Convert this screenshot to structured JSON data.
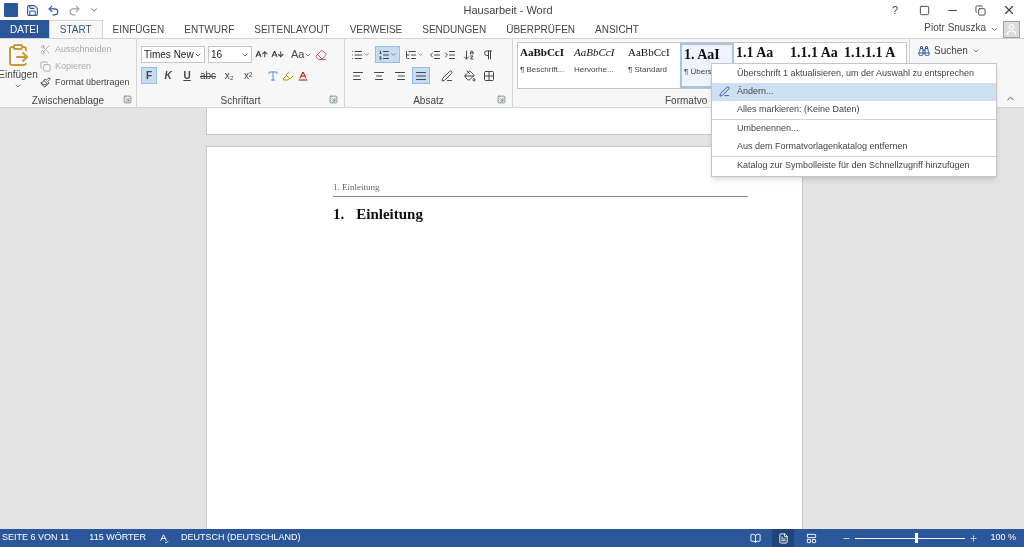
{
  "title_bar": {
    "title": "Hausarbeit - Word",
    "help": "?"
  },
  "tabs": [
    {
      "label": "DATEI",
      "kind": "file",
      "selected": false
    },
    {
      "label": "START",
      "kind": "tab",
      "selected": true
    },
    {
      "label": "EINFÜGEN",
      "kind": "tab",
      "selected": false
    },
    {
      "label": "ENTWURF",
      "kind": "tab",
      "selected": false
    },
    {
      "label": "SEITENLAYOUT",
      "kind": "tab",
      "selected": false
    },
    {
      "label": "VERWEISE",
      "kind": "tab",
      "selected": false
    },
    {
      "label": "SENDUNGEN",
      "kind": "tab",
      "selected": false
    },
    {
      "label": "ÜBERPRÜFEN",
      "kind": "tab",
      "selected": false
    },
    {
      "label": "ANSICHT",
      "kind": "tab",
      "selected": false
    }
  ],
  "user": {
    "name": "Piotr Snuszka"
  },
  "clipboard": {
    "label": "Zwischenablage",
    "paste": "Einfügen",
    "items": [
      {
        "label": "Ausschneiden",
        "disabled": true
      },
      {
        "label": "Kopieren",
        "disabled": true
      },
      {
        "label": "Format übertragen",
        "disabled": false
      }
    ]
  },
  "font": {
    "label": "Schriftart",
    "font_name": "Times New",
    "font_size": "16",
    "case_button": "Aa",
    "format_buttons": [
      {
        "label": "F",
        "kind": "bold",
        "selected": true
      },
      {
        "label": "K",
        "kind": "italic",
        "selected": false
      },
      {
        "label": "U",
        "kind": "underline",
        "selected": false
      },
      {
        "label": "abc",
        "kind": "strike",
        "selected": false
      },
      {
        "label": "x₂",
        "kind": "sub",
        "selected": false
      },
      {
        "label": "x²",
        "kind": "sup",
        "selected": false
      }
    ]
  },
  "paragraph": {
    "label": "Absatz",
    "lists": [
      {
        "selected": false
      },
      {
        "selected": true
      },
      {
        "selected": false
      }
    ],
    "alignment": [
      {
        "selected": false
      },
      {
        "selected": false
      },
      {
        "selected": false
      },
      {
        "selected": true
      }
    ]
  },
  "styles": {
    "label": "Formatvo",
    "items": [
      {
        "preview": "AaBbCcI",
        "name": "¶ Beschrift...",
        "kind": "bold",
        "selected": false
      },
      {
        "preview": "AaBbCcI",
        "name": "Hervorhe...",
        "kind": "italic",
        "selected": false
      },
      {
        "preview": "AaBbCcI",
        "name": "¶ Standard",
        "kind": "normal",
        "selected": false
      },
      {
        "preview": "1. AaI",
        "name": "¶ Übers",
        "kind": "heading",
        "selected": true
      },
      {
        "preview": "1.1 Aa",
        "kind": "heading",
        "selected": false
      },
      {
        "preview": "1.1.1 Aa",
        "kind": "heading",
        "selected": false
      },
      {
        "preview": "1.1.1.1 A",
        "kind": "heading",
        "selected": false
      }
    ]
  },
  "editing": {
    "search": "Suchen"
  },
  "context_menu": {
    "sections": [
      [
        {
          "label": "Überschrift 1 aktualisieren, um der Auswahl zu entsprechen",
          "selected": false,
          "icon": false
        },
        {
          "label": "Ändern...",
          "selected": true,
          "icon": true
        },
        {
          "label": "Alles markieren: (Keine Daten)",
          "selected": false,
          "icon": false
        }
      ],
      [
        {
          "label": "Umbenennen...",
          "selected": false,
          "icon": false
        },
        {
          "label": "Aus dem Formatvorlagenkatalog entfernen",
          "selected": false,
          "icon": false
        }
      ],
      [
        {
          "label": "Katalog zur Symbolleiste für den Schnellzugriff hinzufügen",
          "selected": false,
          "icon": false
        }
      ]
    ]
  },
  "document": {
    "header": "1. Einleitung",
    "heading_number": "1.",
    "heading_text": "Einleitung"
  },
  "status_bar": {
    "page": "SEITE 6 VON 11",
    "words": "115 WÖRTER",
    "language": "DEUTSCH (DEUTSCHLAND)",
    "views": [
      {
        "selected": false
      },
      {
        "selected": true
      },
      {
        "selected": false
      }
    ],
    "zoom_slider": {
      "level": 0.55
    },
    "zoom": "100 %"
  }
}
